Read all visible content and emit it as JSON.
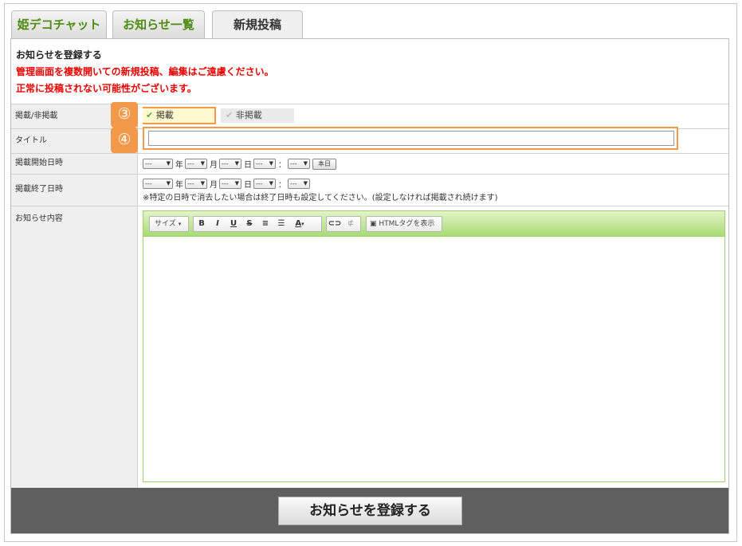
{
  "tabs": [
    {
      "label": "姫デコチャット"
    },
    {
      "label": "お知らせ一覧"
    },
    {
      "label": "新規投稿"
    }
  ],
  "notice": {
    "title": "お知らせを登録する",
    "warning_line1": "管理画面を複数開いての新規投稿、編集はご遠慮ください。",
    "warning_line2": "正常に投稿されない可能性がございます。"
  },
  "form": {
    "status_label": "掲載/非掲載",
    "status_options": [
      {
        "label": "掲載",
        "checked": true
      },
      {
        "label": "非掲載",
        "checked": false
      }
    ],
    "title_label": "タイトル",
    "title_value": "",
    "start_label": "掲載開始日時",
    "end_label": "掲載終了日時",
    "select_placeholder": "---",
    "unit_year": "年",
    "unit_month": "月",
    "unit_day": "日",
    "time_sep": "：",
    "today_button": "本日",
    "end_note": "※特定の日時で消去したい場合は終了日時も設定してください。(設定しなければ掲載され続けます)",
    "content_label": "お知らせ内容"
  },
  "markers": {
    "m3": "③",
    "m4": "④"
  },
  "editor": {
    "size_label": "サイズ",
    "bold": "B",
    "italic": "I",
    "underline": "U",
    "strike": "S",
    "font_color": "A",
    "html_toggle": "HTMLタグを表示"
  },
  "footer": {
    "submit_label": "お知らせを登録する"
  },
  "colors": {
    "accent_orange": "#f29a4a",
    "warning_red": "#ee0000",
    "tab_green": "#4e8a10",
    "toolbar_green": "#a8dc72",
    "footer_gray": "#5f5f5f"
  }
}
